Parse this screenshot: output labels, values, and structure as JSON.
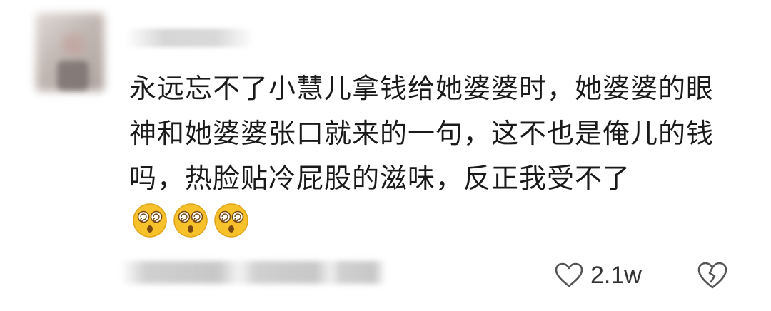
{
  "comment": {
    "text": "永远忘不了小慧儿拿钱给她婆婆时，她婆婆的眼神和她婆婆张口就来的一句，这不也是俺儿的钱吗，热脸贴冷屁股的滋味，反正我受不了",
    "emojis": [
      "dizzy-face-emoji",
      "dizzy-face-emoji",
      "dizzy-face-emoji"
    ]
  },
  "actions": {
    "like_icon": "heart-outline-icon",
    "like_count": "2.1w",
    "dislike_icon": "broken-heart-icon"
  },
  "colors": {
    "text": "#1a1a1a",
    "icon": "#555555",
    "emoji_fill": "#f7c12b"
  }
}
